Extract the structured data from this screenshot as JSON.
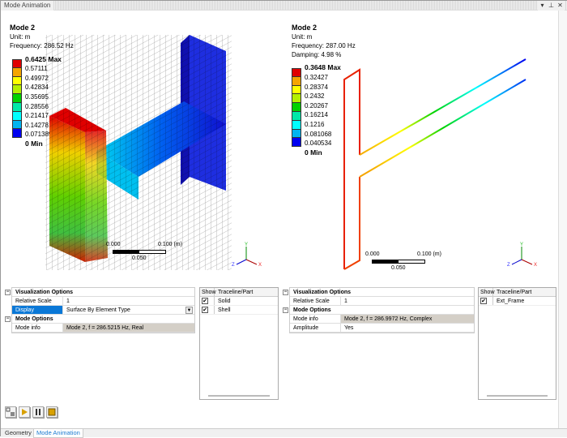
{
  "window": {
    "title": "Mode Animation",
    "controls": [
      "▾",
      "⊥",
      "✕"
    ]
  },
  "left_view": {
    "title": "Mode 2",
    "unit": "Unit: m",
    "frequency": "Frequency: 286.52 Hz",
    "legend": [
      "0.6425 Max",
      "0.57111",
      "0.49972",
      "0.42834",
      "0.35695",
      "0.28556",
      "0.21417",
      "0.14278",
      "0.071389",
      "0 Min"
    ],
    "scale": {
      "start": "0.000",
      "end": "0.100 (m)",
      "mid": "0.050"
    }
  },
  "right_view": {
    "title": "Mode 2",
    "unit": "Unit: m",
    "frequency": "Frequency: 287.00 Hz",
    "damping": "Damping: 4.98 %",
    "legend": [
      "0.3648 Max",
      "0.32427",
      "0.28374",
      "0.2432",
      "0.20267",
      "0.16214",
      "0.1216",
      "0.081068",
      "0.040534",
      "0 Min"
    ],
    "scale": {
      "start": "0.000",
      "end": "0.100 (m)",
      "mid": "0.050"
    }
  },
  "legend_colors": [
    "#e00000",
    "#f5a500",
    "#ffff00",
    "#b4f000",
    "#00d200",
    "#00e8a8",
    "#00ffff",
    "#00b4f0",
    "#0000f0"
  ],
  "triad": {
    "x": "X",
    "y": "Y",
    "z": "Z"
  },
  "left_props": {
    "vis_header": "Visualization Options",
    "relative_scale_label": "Relative Scale",
    "relative_scale": "1",
    "display_label": "Display",
    "display": "Surface By Element Type",
    "mode_header": "Mode Options",
    "mode_info_label": "Mode info",
    "mode_info": "Mode 2, f = 286.5215 Hz, Real"
  },
  "left_table": {
    "headers": [
      "Show",
      "Traceline/Part"
    ],
    "rows": [
      {
        "checked": "✔",
        "name": "Solid"
      },
      {
        "checked": "✔",
        "name": "Shell"
      }
    ]
  },
  "right_props": {
    "vis_header": "Visualization Options",
    "relative_scale_label": "Relative Scale",
    "relative_scale": "1",
    "mode_header": "Mode Options",
    "mode_info_label": "Mode info",
    "mode_info": "Mode 2, f = 286.9972 Hz, Complex",
    "amplitude_label": "Amplitude",
    "amplitude": "Yes"
  },
  "right_table": {
    "headers": [
      "Show",
      "Traceline/Part"
    ],
    "rows": [
      {
        "checked": "✔",
        "name": "Ext_Frame"
      }
    ]
  },
  "tabs": [
    "Geometry",
    "Mode Animation"
  ]
}
